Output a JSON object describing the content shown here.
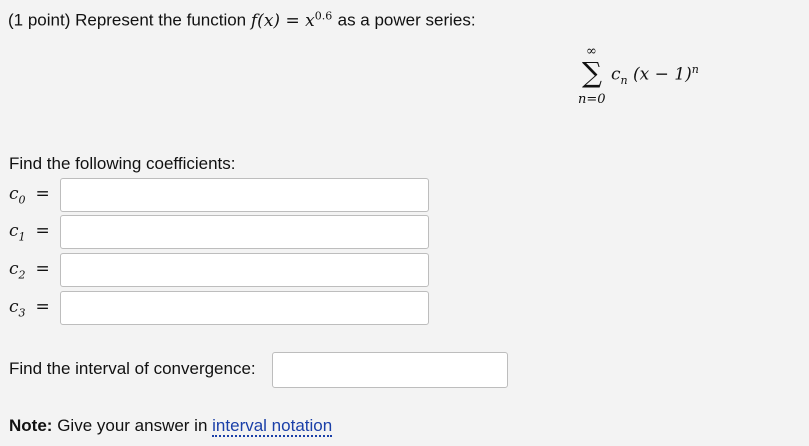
{
  "question": {
    "prefix": "(1 point) Represent the function",
    "func_lhs": "f(x)",
    "func_eq": "=",
    "func_base": "x",
    "func_exp": "0.6",
    "suffix": "as a power series:"
  },
  "series": {
    "upper": "∞",
    "sigma": "∑",
    "lower": "n=0",
    "coef": "c",
    "coef_sub": "n",
    "term": "(x − 1)",
    "term_exp": "n"
  },
  "coefficients": {
    "heading": "Find the following coefficients:",
    "items": [
      {
        "base": "c",
        "sub": "0",
        "eq": "=",
        "value": ""
      },
      {
        "base": "c",
        "sub": "1",
        "eq": "=",
        "value": ""
      },
      {
        "base": "c",
        "sub": "2",
        "eq": "=",
        "value": ""
      },
      {
        "base": "c",
        "sub": "3",
        "eq": "=",
        "value": ""
      }
    ]
  },
  "interval": {
    "label": "Find the interval of convergence:",
    "value": ""
  },
  "note": {
    "bold": "Note:",
    "text": "Give your answer in",
    "link": "interval notation"
  }
}
